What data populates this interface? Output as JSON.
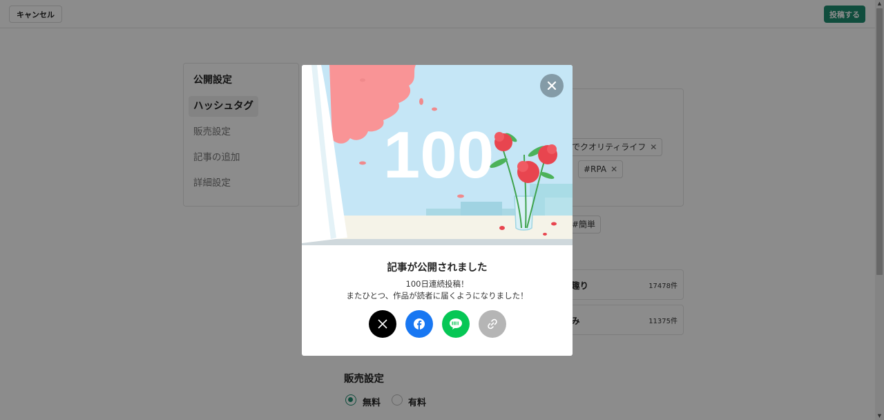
{
  "header": {
    "cancel_label": "キャンセル",
    "post_label": "投稿する"
  },
  "sidebar": {
    "items": [
      {
        "label": "公開設定"
      },
      {
        "label": "ハッシュタグ"
      },
      {
        "label": "販売設定"
      },
      {
        "label": "記事の追加"
      },
      {
        "label": "詳細設定"
      }
    ]
  },
  "hashtags": {
    "selected": [
      "でクオリティライフ",
      "#RPA"
    ],
    "suggested": [
      "#簡単"
    ],
    "popular": [
      {
        "name": "趣り",
        "count": "17478件"
      },
      {
        "name": "み",
        "count": "11375件"
      }
    ]
  },
  "sales": {
    "title": "販売設定",
    "options": [
      {
        "label": "無料",
        "selected": true
      },
      {
        "label": "有料",
        "selected": false
      }
    ]
  },
  "modal": {
    "hero_number": "100",
    "title": "記事が公開されました",
    "line1": "100日連続投稿！",
    "line2": "またひとつ、作品が読者に届くようになりました！",
    "share": [
      {
        "icon": "x-icon",
        "color": "#000000"
      },
      {
        "icon": "facebook-icon",
        "color": "#1877f2"
      },
      {
        "icon": "line-icon",
        "color": "#06c755"
      },
      {
        "icon": "link-icon",
        "color": "#b5b5b5"
      }
    ]
  },
  "colors": {
    "accent": "#1e8c70",
    "sky": "#c5e6f6",
    "flower": "#e8454f"
  }
}
